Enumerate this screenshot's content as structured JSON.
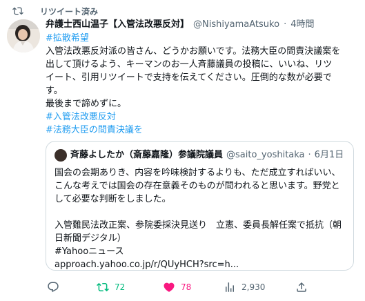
{
  "retweet": {
    "label": "リツイート済み"
  },
  "tweet": {
    "author_name": "弁護士西山温子【入管法改悪反対】",
    "handle": "@NishiyamaAtsuko",
    "separator": "·",
    "time": "4時間",
    "lines": [
      {
        "text": "#拡散希望",
        "hashtag": true
      },
      {
        "text": "入管法改悪反対派の皆さん、どうかお願いです。法務大臣の問責決議案を",
        "hashtag": false
      },
      {
        "text": "出して頂けるよう、キーマンのお一人斉藤議員の投稿に、いいね、リツ",
        "hashtag": false
      },
      {
        "text": "イート、引用リツイートで支持を伝えてください。圧倒的な数が必要で",
        "hashtag": false
      },
      {
        "text": "す。",
        "hashtag": false
      },
      {
        "text": "最後まで諦めずに。",
        "hashtag": false
      },
      {
        "text": "#入管法改悪反対",
        "hashtag": true
      },
      {
        "text": "#法務大臣の問責決議を",
        "hashtag": true
      }
    ]
  },
  "quote": {
    "author_name": "斉藤よしたか（斎藤嘉隆）参議院議員",
    "handle": "@saito_yoshitaka",
    "separator": "·",
    "time": "6月1日",
    "lines": [
      "国会の会期ありき、内容を吟味検討するよりも、ただ成立すればいい、",
      "こんな考えでは国会の存在意義そのものが問われると思います。野党と",
      "して必要な判断をしました。",
      "",
      "入管難民法改正案、参院委採決見送り　立憲、委員長解任案で抵抗（朝",
      "日新聞デジタル）",
      "#Yahooニュース",
      "approach.yahoo.co.jp/r/QUyHCH?src=h..."
    ]
  },
  "actions": {
    "retweets": "72",
    "likes": "78",
    "views": "2,930"
  },
  "colors": {
    "accent": "#1d9bf0",
    "retweet_green": "#00ba7c",
    "like_pink": "#f91880",
    "muted": "#536471"
  },
  "icons": [
    "retweet-icon",
    "reply-icon",
    "like-icon",
    "views-icon",
    "share-icon"
  ]
}
